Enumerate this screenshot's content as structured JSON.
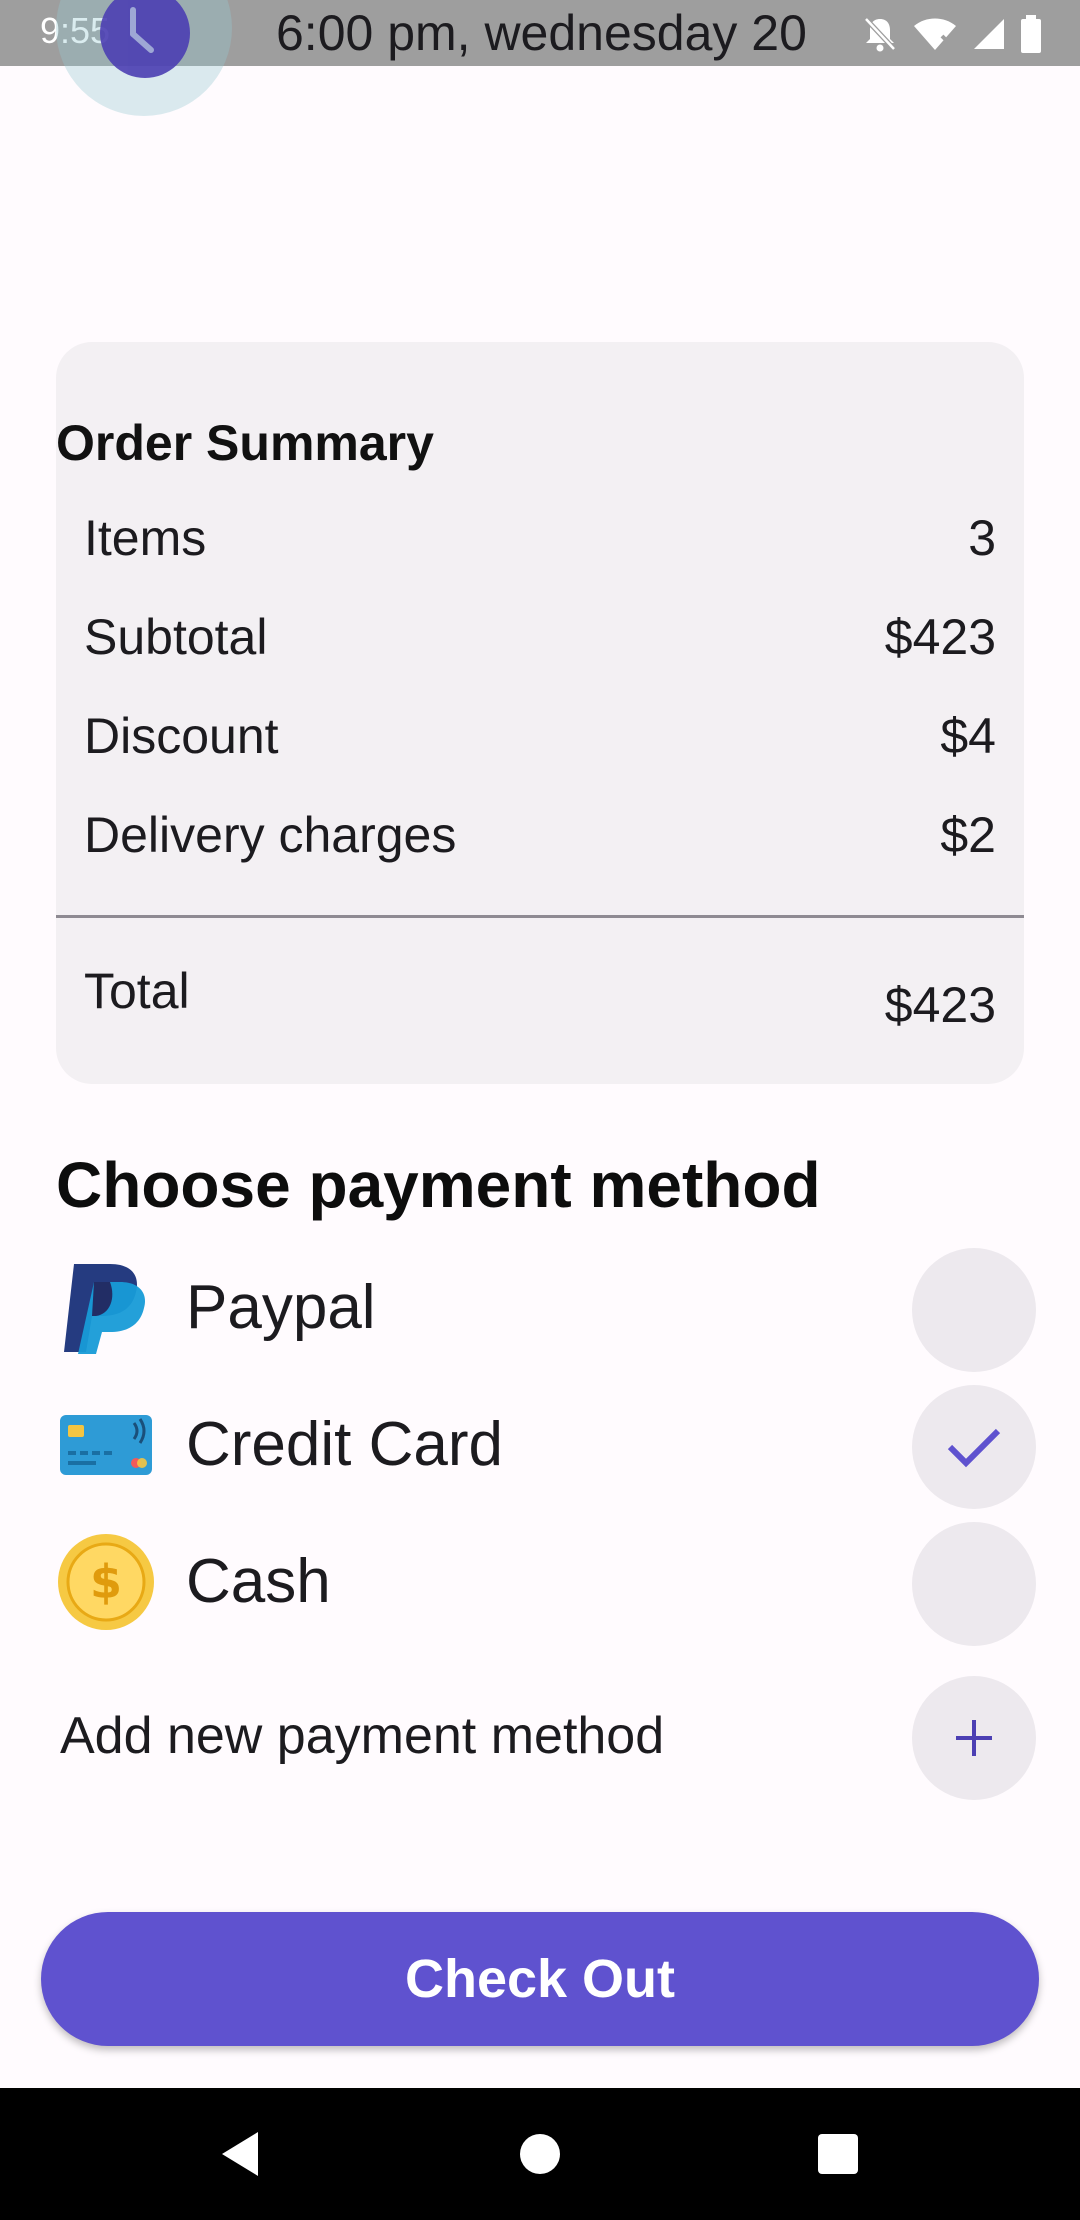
{
  "status_bar": {
    "time": "9:55",
    "date_text": "6:00 pm, wednesday 20"
  },
  "order_summary": {
    "title": "Order Summary",
    "rows": [
      {
        "label": "Items",
        "value": "3"
      },
      {
        "label": "Subtotal",
        "value": "$423"
      },
      {
        "label": "Discount",
        "value": "$4"
      },
      {
        "label": "Delivery charges",
        "value": "$2"
      }
    ],
    "total": {
      "label": "Total",
      "value": "$423"
    }
  },
  "payment": {
    "heading": "Choose payment method",
    "methods": [
      {
        "label": "Paypal",
        "icon": "paypal-logo-icon",
        "selected": false
      },
      {
        "label": "Credit Card",
        "icon": "credit-card-icon",
        "selected": true
      },
      {
        "label": "Cash",
        "icon": "dollar-coin-icon",
        "selected": false
      }
    ],
    "add_label": "Add new payment method"
  },
  "checkout": {
    "label": "Check Out"
  },
  "colors": {
    "accent": "#5F52CF",
    "card_background": "#F3F0F3",
    "check_color": "#5F52CF"
  }
}
